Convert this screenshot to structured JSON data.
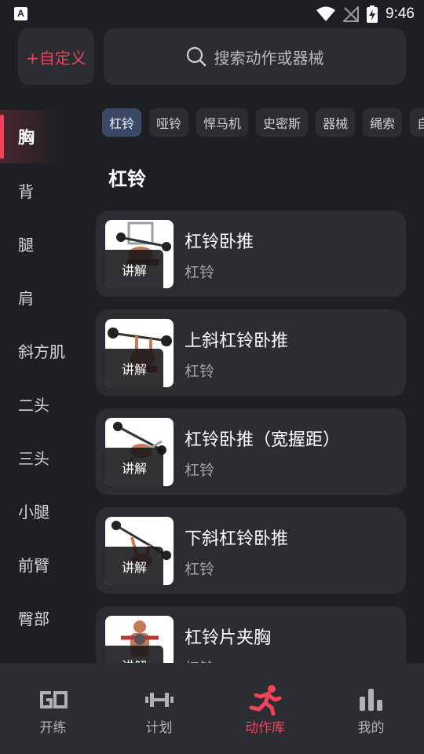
{
  "status_bar": {
    "time": "9:46",
    "app_icon_glyph": "A"
  },
  "header": {
    "custom_label": "+自定义",
    "search_placeholder": "搜索动作或器械"
  },
  "sidebar": {
    "active_index": 0,
    "items": [
      "胸",
      "背",
      "腿",
      "肩",
      "斜方肌",
      "二头",
      "三头",
      "小腿",
      "前臂",
      "臀部"
    ]
  },
  "filters": {
    "active_index": 0,
    "chips": [
      "杠铃",
      "哑铃",
      "悍马机",
      "史密斯",
      "器械",
      "绳索",
      "自"
    ]
  },
  "section": {
    "title": "杠铃"
  },
  "exercises": [
    {
      "name": "杠铃卧推",
      "equipment": "杠铃",
      "badge": "讲解"
    },
    {
      "name": "上斜杠铃卧推",
      "equipment": "杠铃",
      "badge": "讲解"
    },
    {
      "name": "杠铃卧推（宽握距）",
      "equipment": "杠铃",
      "badge": "讲解"
    },
    {
      "name": "下斜杠铃卧推",
      "equipment": "杠铃",
      "badge": "讲解"
    },
    {
      "name": "杠铃片夹胸",
      "equipment": "杠铃",
      "badge": "讲解"
    }
  ],
  "bottom_nav": {
    "active_index": 2,
    "items": [
      {
        "label": "开练",
        "icon": "go-icon"
      },
      {
        "label": "计划",
        "icon": "dumbbell-icon"
      },
      {
        "label": "动作库",
        "icon": "running-person-icon"
      },
      {
        "label": "我的",
        "icon": "bar-chart-icon"
      }
    ]
  },
  "colors": {
    "accent": "#f0425a",
    "background": "#1e1f23",
    "surface": "#2c2d32",
    "chip_active": "#3a4a66"
  }
}
